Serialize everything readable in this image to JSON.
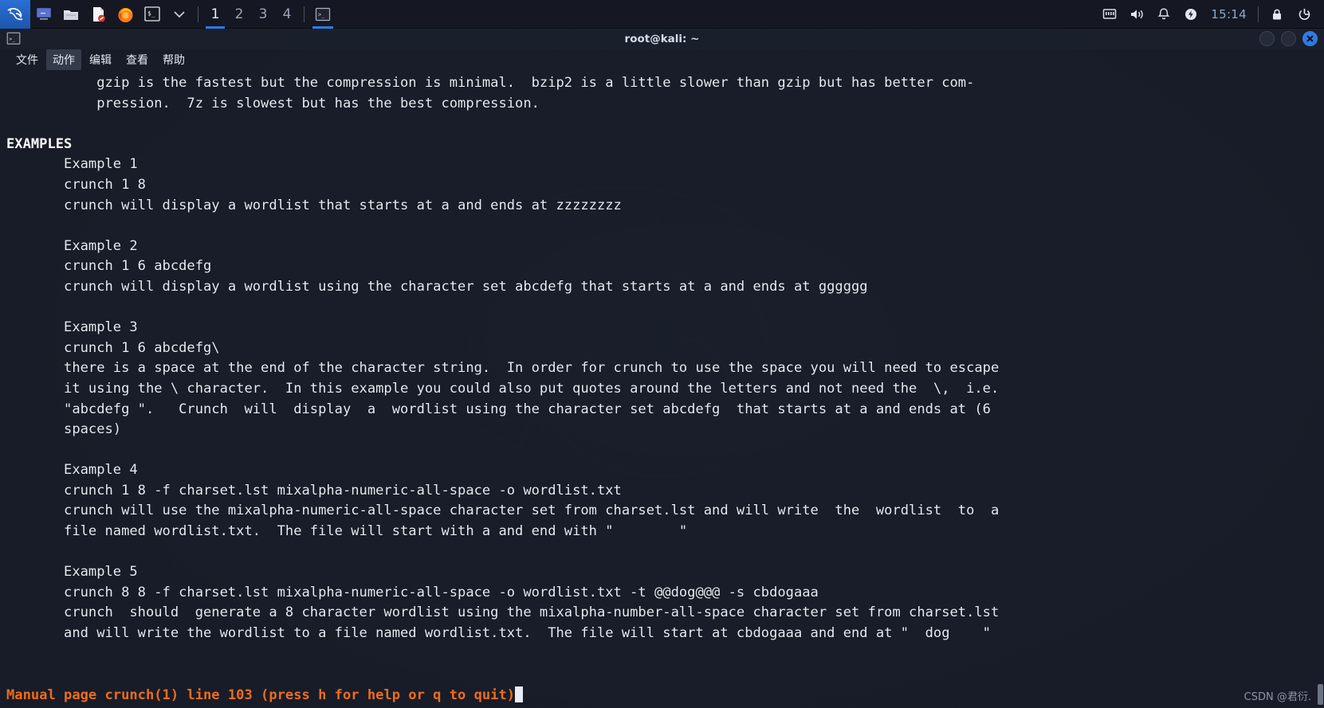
{
  "panel": {
    "kali_menu_icon": "kali-dragon-icon",
    "launchers": [
      {
        "name": "terminal-emulator-launcher",
        "icon": "monitor-icon"
      },
      {
        "name": "file-manager-launcher",
        "icon": "folder-icon"
      },
      {
        "name": "text-editor-launcher",
        "icon": "document-icon"
      },
      {
        "name": "firefox-launcher",
        "icon": "firefox-icon"
      },
      {
        "name": "terminal-launcher",
        "icon": "terminal-prompt-icon"
      },
      {
        "name": "launcher-dropdown",
        "icon": "chevron-down-icon"
      }
    ],
    "workspaces": [
      {
        "label": "1",
        "active": true
      },
      {
        "label": "2",
        "active": false
      },
      {
        "label": "3",
        "active": false
      },
      {
        "label": "4",
        "active": false
      }
    ],
    "window_task": {
      "name": "taskbar-window-terminal",
      "icon": "terminal-window-icon"
    },
    "tray": [
      {
        "name": "network-icon",
        "icon": "ethernet-icon"
      },
      {
        "name": "volume-icon",
        "icon": "speaker-icon"
      },
      {
        "name": "notifications-icon",
        "icon": "bell-icon"
      },
      {
        "name": "power-manager-icon",
        "icon": "power-bolt-icon"
      }
    ],
    "clock": "15:14",
    "session": [
      {
        "name": "lock-screen-icon",
        "icon": "padlock-icon"
      },
      {
        "name": "logout-icon",
        "icon": "power-exit-icon"
      }
    ]
  },
  "window": {
    "title": "root@kali: ~",
    "icon": "terminal-window-icon",
    "controls": {
      "minimize": "minimize-button",
      "maximize": "maximize-button",
      "close": "close-button"
    },
    "menu": [
      {
        "label": "文件",
        "highlighted": false
      },
      {
        "label": "动作",
        "highlighted": true
      },
      {
        "label": "编辑",
        "highlighted": false
      },
      {
        "label": "查看",
        "highlighted": false
      },
      {
        "label": "帮助",
        "highlighted": false
      }
    ]
  },
  "terminal": {
    "content": "           gzip is the fastest but the compression is minimal.  bzip2 is a little slower than gzip but has better com-\n           pression.  7z is slowest but has the best compression.\n\nEXAMPLES\n       Example 1\n       crunch 1 8\n       crunch will display a wordlist that starts at a and ends at zzzzzzzz\n\n       Example 2\n       crunch 1 6 abcdefg\n       crunch will display a wordlist using the character set abcdefg that starts at a and ends at gggggg\n\n       Example 3\n       crunch 1 6 abcdefg\\\n       there is a space at the end of the character string.  In order for crunch to use the space you will need to escape\n       it using the \\ character.  In this example you could also put quotes around the letters and not need the  \\,  i.e.\n       \"abcdefg \".   Crunch  will  display  a  wordlist using the character set abcdefg  that starts at a and ends at (6\n       spaces)\n\n       Example 4\n       crunch 1 8 -f charset.lst mixalpha-numeric-all-space -o wordlist.txt\n       crunch will use the mixalpha-numeric-all-space character set from charset.lst and will write  the  wordlist  to  a\n       file named wordlist.txt.  The file will start with a and end with \"        \"\n\n       Example 5\n       crunch 8 8 -f charset.lst mixalpha-numeric-all-space -o wordlist.txt -t @@dog@@@ -s cbdogaaa\n       crunch  should  generate a 8 character wordlist using the mixalpha-number-all-space character set from charset.lst\n       and will write the wordlist to a file named wordlist.txt.  The file will start at cbdogaaa and end at \"  dog    \"",
    "section_heading": "EXAMPLES",
    "status_line": "Manual page crunch(1) line 103 (press h for help or q to quit)",
    "status_color": "#ef6c1a",
    "cursor": "block-cursor"
  },
  "watermark": "CSDN @君衍."
}
